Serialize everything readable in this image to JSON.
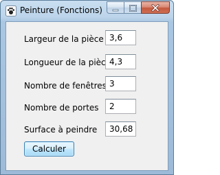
{
  "window": {
    "title": "Peinture (Fonctions)"
  },
  "form": {
    "rows": [
      {
        "label": "Largeur de la pièce",
        "value": "3,6"
      },
      {
        "label": "Longueur de la pièce",
        "value": "4,3"
      },
      {
        "label": "Nombre de fenêtres",
        "value": "3"
      },
      {
        "label": "Nombre de portes",
        "value": "2"
      },
      {
        "label": "Surface à peindre",
        "value": "30,68"
      }
    ],
    "calculate_label": "Calculer"
  },
  "icons": {
    "app": "paw-print-icon",
    "minimize": "minimize-icon",
    "maximize": "maximize-icon",
    "close": "close-icon"
  },
  "colors": {
    "frame": "#bcd4ea",
    "client_background": "#f0f0f0",
    "close_button": "#c45a3f"
  }
}
